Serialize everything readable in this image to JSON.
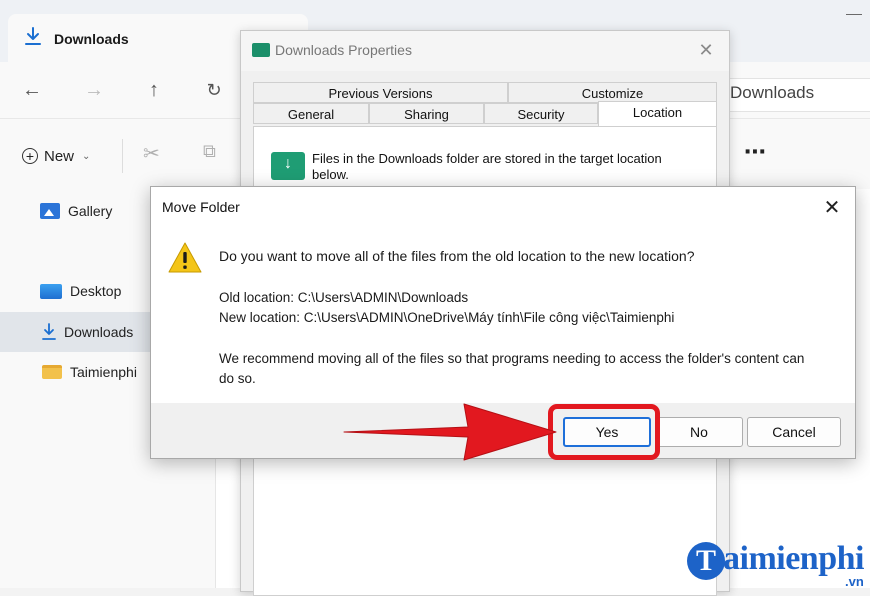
{
  "explorer": {
    "tab_title": "Downloads",
    "address_tail": "Downloads",
    "toolbar": {
      "new_label": "New"
    },
    "sidebar": {
      "gallery": "Gallery",
      "desktop": "Desktop",
      "downloads": "Downloads",
      "taimienphi": "Taimienphi"
    }
  },
  "properties": {
    "title": "Downloads Properties",
    "tabs": {
      "previous_versions": "Previous Versions",
      "customize": "Customize",
      "general": "General",
      "sharing": "Sharing",
      "security": "Security",
      "location": "Location"
    },
    "active_tab": "Location",
    "description": "Files in the Downloads folder are stored in the target location below."
  },
  "move_dialog": {
    "title": "Move Folder",
    "question": "Do you want to move all of the files from the old location to the new location?",
    "old_location": "Old location: C:\\Users\\ADMIN\\Downloads",
    "new_location": "New location: C:\\Users\\ADMIN\\OneDrive\\Máy tính\\File công việc\\Taimienphi",
    "recommendation": "We recommend moving all of the files so that programs needing to access the folder's content can do so.",
    "buttons": {
      "yes": "Yes",
      "no": "No",
      "cancel": "Cancel"
    }
  },
  "watermark": {
    "mark": "T",
    "text": "aimienphi",
    "suffix": ".vn"
  },
  "colors": {
    "highlight": "#e2181f",
    "accent": "#1e6fd9",
    "folder_green": "#1f9d74",
    "warning": "#f4c518",
    "watermark": "#1d63c8"
  },
  "icons": {
    "download": "download-arrow-icon",
    "back": "arrow-left-icon",
    "forward": "arrow-right-icon",
    "up": "arrow-up-icon",
    "refresh": "refresh-icon",
    "new": "plus-circle-icon",
    "cut": "scissors-icon",
    "copy": "copy-icon",
    "more": "ellipsis-icon",
    "warning": "warning-triangle-icon",
    "close": "close-icon"
  }
}
